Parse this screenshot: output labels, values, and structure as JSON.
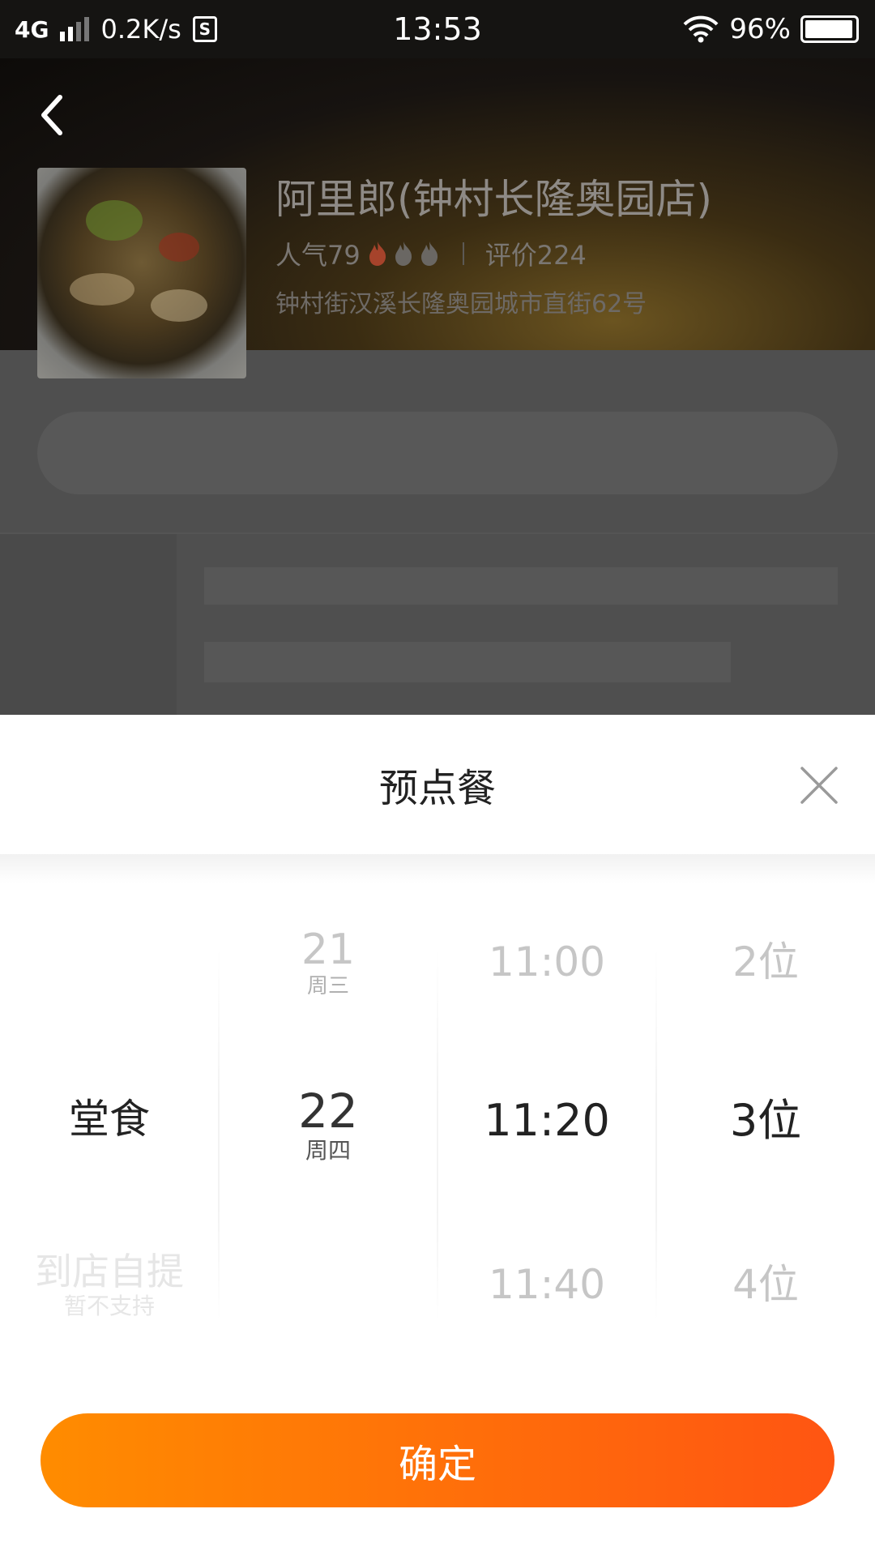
{
  "status_bar": {
    "network": "4G",
    "speed": "0.2K/s",
    "sim_icon": "S",
    "time": "13:53",
    "battery": "96%",
    "battery_level": 0.96
  },
  "shop": {
    "name": "阿里郎(钟村长隆奥园店)",
    "popularity": "人气79",
    "popularity_flames_lit": 1,
    "popularity_flames_total": 3,
    "reviews": "评价224",
    "address": "钟村街汉溪长隆奥园城市直街62号"
  },
  "sheet": {
    "title": "预点餐",
    "confirm_label": "确定",
    "columns": {
      "type": [
        {
          "main": "堂食",
          "selected": true
        },
        {
          "main": "到店自提",
          "sub": "暂不支持",
          "disabled": true
        }
      ],
      "date": [
        {
          "main": "21",
          "sub": "周三"
        },
        {
          "main": "22",
          "sub": "周四",
          "selected": true
        }
      ],
      "time": [
        {
          "main": "11:00"
        },
        {
          "main": "11:20",
          "selected": true
        },
        {
          "main": "11:40"
        }
      ],
      "people": [
        {
          "main": "2位"
        },
        {
          "main": "3位",
          "selected": true
        },
        {
          "main": "4位"
        }
      ]
    }
  },
  "colors": {
    "accent_start": "#ff8c00",
    "accent_end": "#ff5512",
    "flame_lit": "#a6432b",
    "flame_unlit": "#6a6763",
    "selected_text": "#222222",
    "faded_text": "#c6c6c6"
  },
  "icons": {
    "back": "chevron-left-icon",
    "close": "close-icon",
    "flame": "flame-icon",
    "wifi": "wifi-icon",
    "signal": "signal-icon",
    "battery": "battery-icon"
  }
}
